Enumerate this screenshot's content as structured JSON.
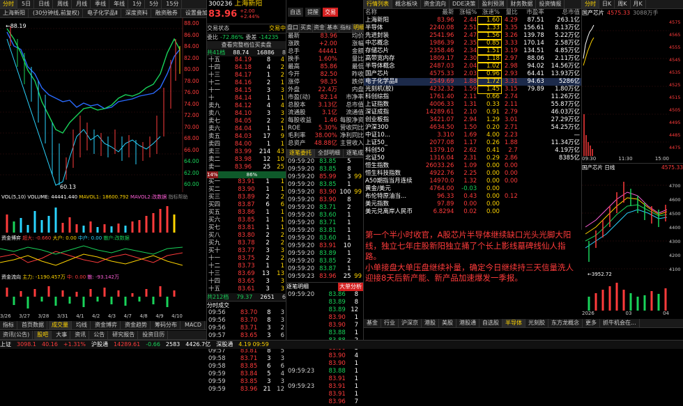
{
  "chart_toolbar": {
    "tabs": [
      "分时",
      "5日",
      "日线",
      "周线",
      "月线",
      "季线",
      "年线",
      "1分",
      "5分",
      "15分",
      "30分",
      "60分",
      "分钟",
      "多周期"
    ],
    "ticker": "上海新阳",
    "sub": "(30分钟线,前复权)",
    "badge_items": [
      "电子化学品Ⅱ",
      "深度资料",
      "融资融券",
      "设置叠加"
    ]
  },
  "main_chart": {
    "label": "上海新阳",
    "high_mark": "88.19",
    "low_mark": "60.13",
    "yaxis": [
      "88.00",
      "86.00",
      "84.00",
      "82.00",
      "80.00",
      "78.00",
      "76.00",
      "74.00",
      "72.00",
      "70.00",
      "68.00",
      "66.00",
      "64.00",
      "62.00",
      "60.00"
    ],
    "yaxis_pct": [
      "2.00",
      "4.00",
      "6.00",
      "8.00",
      "2.00",
      "4.00",
      "6.00",
      "8.00",
      "6.00"
    ],
    "dates": [
      "3/26",
      "3/27",
      "3/28",
      "3/31",
      "4/1",
      "4/2",
      "4/3",
      "4/7",
      "4/8",
      "4/9",
      "4/10"
    ]
  },
  "volume_panel": {
    "label": "VOL(5,10)",
    "vol": "VOLUME: 44441.440",
    "ma5": "MAVOL1: 18600.792",
    "ma10": "MAVOL2:改数据",
    "btn": "指标帮助",
    "btn2": "换股帮助"
  },
  "flow_panel": {
    "label": "资金博弈",
    "big": "超大: -0.660",
    "large": "大户: 0.00",
    "mid": "中户: 0.00",
    "small": "散户:改数据",
    "btn": "指标帮助",
    "btn2": "换股帮助"
  },
  "flow2_panel": {
    "label": "资金流向",
    "main": "主力: -1190.457万",
    "mid": "中: 0.00",
    "small": "散: -93.142万",
    "other": "其他:改数据",
    "btn": "指标帮助",
    "btn2": "换股帮助"
  },
  "bottom_tabs": [
    "指标",
    "首页数据",
    "成交量",
    "均线",
    "资金博弈",
    "资金趋势",
    "筹码分布",
    "MACD",
    "更多"
  ],
  "left_bottom": [
    "资讯(公告)",
    "股吧",
    "大事",
    "资讯",
    "公告",
    "研究报告",
    "投资日历",
    "问董秘"
  ],
  "statusbar": {
    "index1_name": "上证",
    "index1_val": "3098.1",
    "index1_chg": "40.16",
    "index1_pct": "+1.31%",
    "index2_name": "沪股通",
    "index2_val": "↑",
    "b1": "14289.61",
    "b2": "-0.66",
    "b3": "2583",
    "b4": "4426.7亿",
    "index3_name": "深股通",
    "time": "4.19 09:59"
  },
  "quote_header": {
    "code": "300236",
    "name": "上海新阳",
    "price": "83.96",
    "chg": "+2.00",
    "pct": "+2.44%",
    "btn_select": "自选",
    "btn_alert": "提醒",
    "btn_trade": "交易"
  },
  "order_book": {
    "tabs_top": [
      "交易状态",
      "交易中"
    ],
    "ratio_label": "委比",
    "ratio_val": "-72.86%",
    "diff_label": "委差",
    "diff_val": "-14235",
    "view_btn": "查看完整档位买卖盘",
    "summary": [
      "共41档",
      "88.74",
      "16886",
      "8"
    ],
    "asks": [
      [
        "十五",
        "84.19",
        "8",
        "4"
      ],
      [
        "十四",
        "84.18",
        "4",
        "2"
      ],
      [
        "十三",
        "84.17",
        "1",
        "2"
      ],
      [
        "十二",
        "84.16",
        "2",
        "1"
      ],
      [
        "十一",
        "84.15",
        "3",
        "3"
      ],
      [
        "十",
        "84.14",
        "1",
        "1"
      ],
      [
        "卖九",
        "84.12",
        "4",
        "4"
      ],
      [
        "卖八",
        "84.10",
        "3",
        "3"
      ],
      [
        "卖七",
        "84.05",
        "2",
        "2"
      ],
      [
        "卖六",
        "84.04",
        "1",
        "1"
      ],
      [
        "卖五",
        "84.03",
        "17",
        "9"
      ],
      [
        "卖四",
        "84.00",
        "1",
        "1"
      ],
      [
        "卖三",
        "83.99",
        "214",
        "43"
      ],
      [
        "卖二",
        "83.98",
        "12",
        "10"
      ],
      [
        "卖一",
        "83.96",
        "25",
        "25"
      ]
    ],
    "spread": [
      "14%",
      "86%"
    ],
    "bids": [
      [
        "买一",
        "83.91",
        "1",
        "1"
      ],
      [
        "买二",
        "83.90",
        "1",
        "1"
      ],
      [
        "买三",
        "83.89",
        "2",
        "2"
      ],
      [
        "买四",
        "83.87",
        "6",
        "6"
      ],
      [
        "买五",
        "83.86",
        "1",
        "1"
      ],
      [
        "买六",
        "83.85",
        "1",
        "1"
      ],
      [
        "买七",
        "83.81",
        "1",
        "1"
      ],
      [
        "买八",
        "83.80",
        "2",
        "2"
      ],
      [
        "买九",
        "83.78",
        "2",
        "2"
      ],
      [
        "买十",
        "83.77",
        "3",
        "3"
      ],
      [
        "十一",
        "83.75",
        "2",
        "2"
      ],
      [
        "十二",
        "83.73",
        "1",
        "1"
      ],
      [
        "十三",
        "83.69",
        "13",
        "13"
      ],
      [
        "十四",
        "83.65",
        "3",
        "3"
      ],
      [
        "十五",
        "83.61",
        "3",
        "3"
      ]
    ],
    "bottom": [
      "共212档",
      "79.37",
      "2651",
      "6"
    ]
  },
  "quote_stats": {
    "tabs": [
      "盘口",
      "买卖",
      "资金",
      "基本",
      "指标",
      "明细",
      "股吧",
      "资讯"
    ],
    "rows": [
      [
        "最新",
        "83.96",
        "均价",
        "84.22"
      ],
      [
        "涨跌",
        "+2.00",
        "涨幅",
        "+2.44%"
      ],
      [
        "总手",
        "44441",
        "金额",
        "3.74亿"
      ],
      [
        "换手",
        "1.60%",
        "量比",
        "4.29"
      ],
      [
        "最高",
        "85.86",
        "最低",
        "82.30"
      ],
      [
        "今开",
        "82.50",
        "昨收",
        "81.96"
      ],
      [
        "涨停",
        "98.35",
        "跌停",
        "65.57"
      ],
      [
        "外盘",
        "22.4万",
        "内盘",
        "20293"
      ],
      [
        "市盈(动)",
        "82.14",
        "市净率",
        "5.62"
      ],
      [
        "总股本",
        "3.13亿",
        "总市值",
        "263.1亿"
      ],
      [
        "流通股",
        "3.1亿",
        "流通值",
        "260.8亿"
      ],
      [
        "每股收益",
        "1.46",
        "每股净资",
        "14.94"
      ],
      [
        "ROE",
        "5.30%",
        "营收同比",
        "15.57%"
      ],
      [
        "毛利率",
        "38.00%",
        "净利同比",
        "0.57%"
      ],
      [
        "总资产",
        "48.88亿",
        "主营收入",
        "13.37亿"
      ]
    ]
  },
  "tick_list": {
    "tabs": [
      "逐笔委托",
      "全部明细",
      "逐笔成交"
    ],
    "rows": [
      [
        "09:59:20",
        "83.85",
        "5",
        ""
      ],
      [
        "09:59:20",
        "83.85",
        "8",
        ""
      ],
      [
        "09:59:20",
        "85.99",
        "3",
        "99"
      ],
      [
        "09:59:20",
        "83.85",
        "1",
        ""
      ],
      [
        "09:59:20",
        "83.90",
        "100",
        "99"
      ],
      [
        "09:59:20",
        "83.90",
        "8",
        ""
      ],
      [
        "09:59:20",
        "83.71",
        "2",
        ""
      ],
      [
        "09:59:20",
        "83.60",
        "1",
        ""
      ],
      [
        "09:59:20",
        "83.71",
        "1",
        ""
      ],
      [
        "09:59:20",
        "83.81",
        "1",
        ""
      ],
      [
        "09:59:20",
        "83.60",
        "1",
        ""
      ],
      [
        "09:59:20",
        "83.91",
        "10",
        ""
      ],
      [
        "09:59:20",
        "83.89",
        "1",
        ""
      ],
      [
        "09:59:20",
        "83.85",
        "2",
        ""
      ],
      [
        "09:59:20",
        "83.87",
        "1",
        ""
      ],
      [
        "09:59:23",
        "83.96",
        "25",
        "99"
      ]
    ]
  },
  "big_orders": {
    "label": "逐笔明细",
    "btn": "大单分析",
    "rows": [
      [
        "09:59:20",
        "83.86",
        "8",
        ""
      ],
      [
        "",
        "83.89",
        "8",
        ""
      ],
      [
        "",
        "83.89",
        "12",
        ""
      ],
      [
        "",
        "83.90",
        "1",
        ""
      ],
      [
        "",
        "83.90",
        "7",
        ""
      ],
      [
        "",
        "83.88",
        "1",
        ""
      ],
      [
        "",
        "83.88",
        "2",
        ""
      ],
      [
        "",
        "83.90",
        "3",
        ""
      ],
      [
        "",
        "83.90",
        "4",
        ""
      ],
      [
        "",
        "83.90",
        "1",
        ""
      ],
      [
        "09:59:23",
        "83.88",
        "1",
        ""
      ],
      [
        "",
        "83.91",
        "1",
        ""
      ],
      [
        "09:59:23",
        "83.91",
        "1",
        ""
      ],
      [
        "",
        "83.91",
        "1",
        ""
      ],
      [
        "",
        "83.96",
        "7",
        ""
      ]
    ]
  },
  "minute_list": {
    "label": "分时成交",
    "rows": [
      [
        "09:56",
        "83.70",
        "8",
        "3"
      ],
      [
        "09:56",
        "83.70",
        "8",
        "3"
      ],
      [
        "09:56",
        "83.71",
        "3",
        "2"
      ],
      [
        "09:57",
        "83.65",
        "3",
        "6"
      ],
      [
        "09:57",
        "83.66",
        "7",
        "6"
      ],
      [
        "09:57",
        "83.81",
        "8",
        "5"
      ],
      [
        "09:58",
        "83.71",
        "3",
        "3"
      ],
      [
        "09:58",
        "83.85",
        "6",
        "6"
      ],
      [
        "09:59",
        "83.84",
        "5",
        "4"
      ],
      [
        "09:59",
        "83.85",
        "3",
        "3"
      ],
      [
        "09:59",
        "83.96",
        "21",
        "12"
      ]
    ]
  },
  "sector_table": {
    "tabs": [
      "行情列表",
      "概念板块",
      "资金流向",
      "DDE决策",
      "盈利预测",
      "财务数据",
      "投资情报",
      "多股同列"
    ],
    "headers": [
      "名称",
      "最新",
      "涨幅%",
      "涨速%",
      "量比",
      "市盈率",
      "总市值"
    ],
    "rows": [
      [
        "上海新阳",
        "83.96",
        "2.44",
        "1.60",
        "4.29",
        "87.51",
        "263.1亿"
      ],
      [
        "半导体",
        "2240.08",
        "2.51",
        "1.33",
        "3.35",
        "156.61",
        "8.13万亿"
      ],
      [
        "先进封装",
        "2541.96",
        "2.47",
        "1.56",
        "3.26",
        "139.78",
        "5.22万亿"
      ],
      [
        "中芯概念",
        "1986.39",
        "2.35",
        "0.85",
        "3.33",
        "170.14",
        "2.58万亿"
      ],
      [
        "存储芯片",
        "2358.46",
        "2.34",
        "1.51",
        "3.19",
        "134.51",
        "4.85万亿"
      ],
      [
        "高带宽内存",
        "1809.17",
        "2.30",
        "1.18",
        "2.97",
        "88.06",
        "2.11万亿"
      ],
      [
        "半导体概念",
        "2487.03",
        "2.04",
        "1.02",
        "2.98",
        "94.02",
        "14.56万亿"
      ],
      [
        "国产芯片",
        "4575.33",
        "2.03",
        "0.96",
        "2.93",
        "64.41",
        "13.93万亿"
      ],
      [
        "电子化学品Ⅱ",
        "2549.69",
        "1.88",
        "1.72",
        "3.31",
        "94.63",
        "5286亿"
      ],
      [
        "光刻机(胶)",
        "4232.32",
        "1.59",
        "1.45",
        "3.15",
        "79.89",
        "1.80万亿"
      ],
      [
        "科创综指",
        "1761.40",
        "2.11",
        "0.66",
        "2.74",
        "",
        "11.26万亿"
      ],
      [
        "上证指数",
        "4006.33",
        "1.31",
        "0.33",
        "2.11",
        "",
        "55.87万亿"
      ],
      [
        "深证成指",
        "14289.61",
        "2.10",
        "0.91",
        "2.79",
        "",
        "46.03万亿"
      ],
      [
        "创业板指",
        "3421.07",
        "2.94",
        "1.29",
        "3.01",
        "",
        "27.29万亿"
      ],
      [
        "沪深300",
        "4634.50",
        "1.50",
        "0.20",
        "2.71",
        "",
        "54.25万亿"
      ],
      [
        "中证10...",
        "3.310",
        "1.69",
        "4.00",
        "2.23",
        "",
        "—"
      ],
      [
        "上证50_",
        "2077.08",
        "1.17",
        "0.26",
        "1.88",
        "",
        "11.34万亿"
      ],
      [
        "科创50",
        "1379.10",
        "2.62",
        "0.41",
        "2.7",
        "",
        "4.19万亿"
      ],
      [
        "北证50",
        "1316.04",
        "2.31",
        "0.29",
        "2.86",
        "",
        "8385亿"
      ],
      [
        "恒生指数",
        "26033.26",
        "1.09",
        "0.00",
        "0.00",
        "",
        ""
      ],
      [
        "恒生科技指数",
        "4922.76",
        "2.25",
        "0.00",
        "0.00",
        "",
        ""
      ],
      [
        "A50期指当月连续",
        "14970.0",
        "1.32",
        "0.00",
        "0.00",
        "",
        ""
      ],
      [
        "黄金/美元",
        "4764.00",
        "-0.03",
        "0.00",
        "",
        "",
        ""
      ],
      [
        "布伦特原油当...",
        "96.33",
        "0.43",
        "0.00",
        "0.12",
        "",
        ""
      ],
      [
        "美元指数",
        "97.89",
        "0.00",
        "0.00",
        "",
        "",
        ""
      ],
      [
        "美元兑离岸人民币",
        "6.8294",
        "0.02",
        "0.00",
        "",
        "",
        ""
      ]
    ],
    "bottom_tabs": [
      "基金",
      "行业",
      "沪深京",
      "港股",
      "美股",
      "美股",
      "港股通",
      "自选股",
      "半导体",
      "光刻胶",
      "东方龙概念",
      "更多",
      "抓牛机会在..."
    ]
  },
  "mini_chart": {
    "tabs": [
      "分时",
      "日K",
      "周K",
      "月K"
    ],
    "name": "国产芯片",
    "val": "4575.33",
    "pct": "3088万手",
    "yvals": [
      "4575",
      "4565",
      "4555",
      "4545",
      "4535",
      "4525",
      "4515",
      "4505",
      "4495",
      "4485",
      "4475"
    ],
    "times": [
      "09:30",
      "11:30",
      "15:00"
    ]
  },
  "k_chart": {
    "label": "国产芯片 日线",
    "hi": "4575.33",
    "lo": "3952.72",
    "yvals": [
      "4700",
      "4600",
      "4500",
      "4400",
      "4300",
      "4200",
      "4100",
      "4000",
      "3900"
    ],
    "dates": [
      "2026",
      "03",
      "04"
    ]
  },
  "news": {
    "p1": "第一个半小时收官，A股芯片半导体继续缺口光头光脚大阳线，独立七年庄股新阳独立捅了个长上影线墓碑线仙人指路。",
    "p2": "小单接盘大单压盘继续补量，确定今日继续持三天信量洗人迎接8天后新产能、新产品加速爆发一季报。"
  }
}
